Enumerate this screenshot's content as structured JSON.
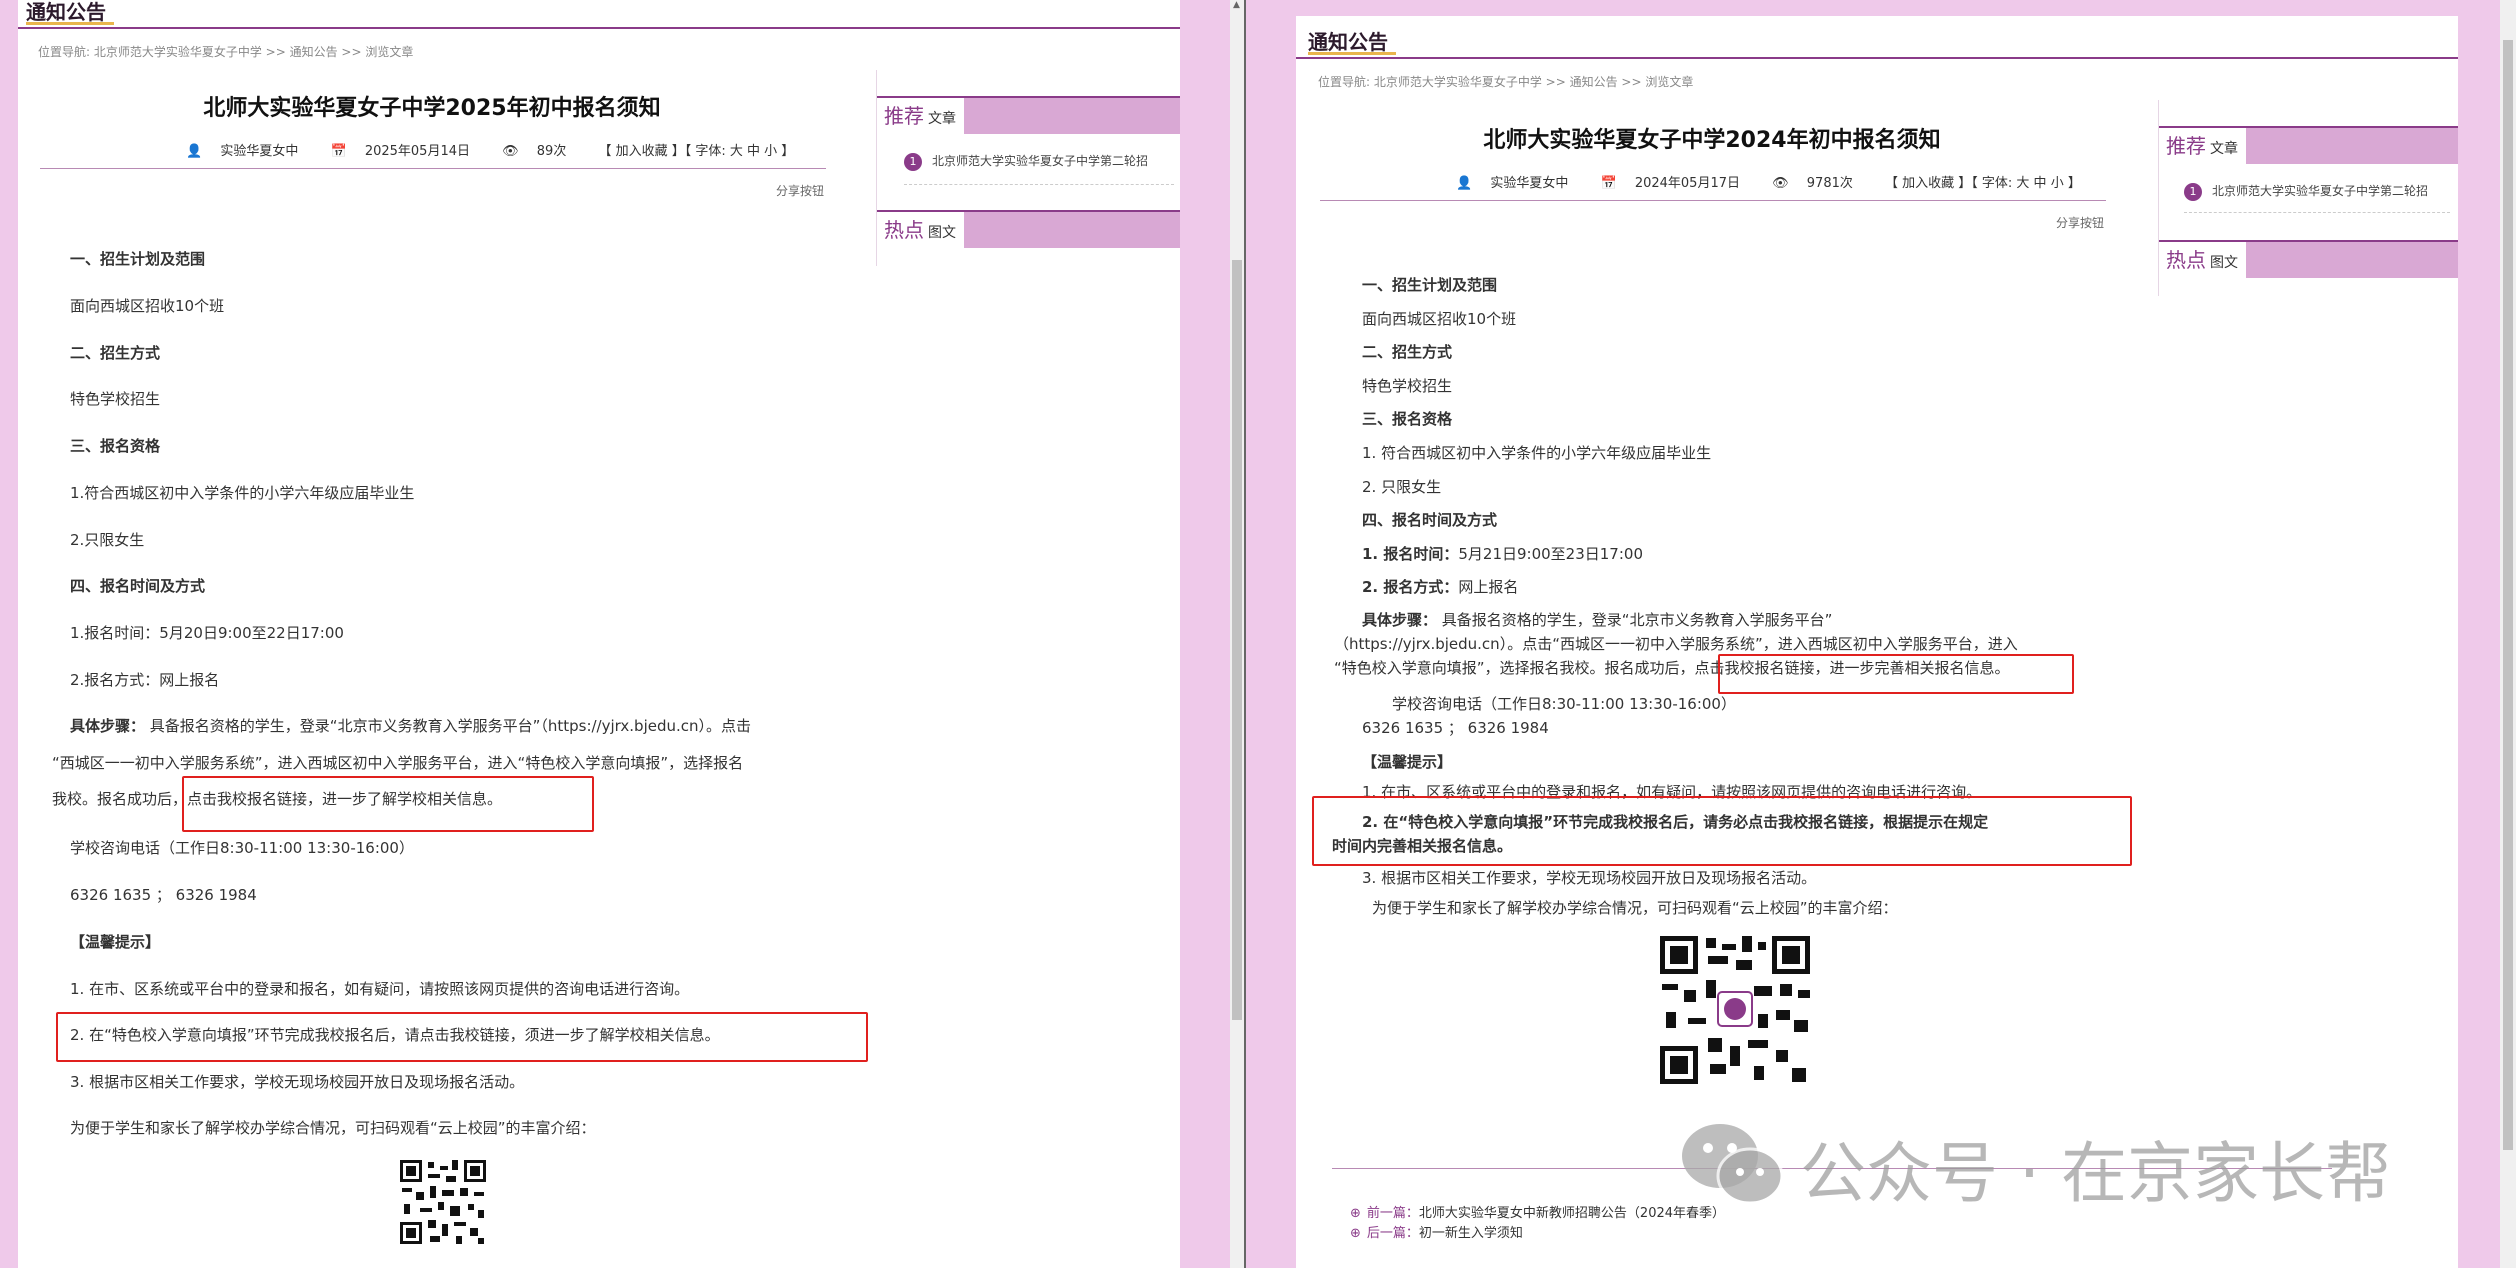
{
  "section_title": "通知公告",
  "breadcrumb": "位置导航: 北京师范大学实验华夏女子中学 >> 通知公告 >> 浏览文章",
  "share_label": "分享按钮",
  "sidebar": {
    "recommend_title": "推荐",
    "recommend_sub": "文章",
    "recommend_item_num": "1",
    "recommend_item": "北京师范大学实验华夏女子中学第二轮招",
    "hot_title": "热点",
    "hot_sub": "图文"
  },
  "left": {
    "title": "北师大实验华夏女子中学2025年初中报名须知",
    "meta": {
      "author": "实验华夏女中",
      "date": "2025年05月14日",
      "views": "89次",
      "actions": "【 加入收藏 】【 字体: 大 中 小 】"
    },
    "paragraphs": [
      "一、招生计划及范围",
      "面向西城区招收10个班",
      "二、招生方式",
      "特色学校招生",
      "三、报名资格",
      "1.符合西城区初中入学条件的小学六年级应届毕业生",
      "2.只限女生",
      "四、报名时间及方式",
      "1.报名时间：5月20日9:00至22日17:00",
      "2.报名方式：网上报名"
    ],
    "steps_label": "具体步骤：",
    "steps_line1": "具备报名资格的学生，登录“北京市义务教育入学服务平台”（https://yjrx.bjedu.cn）。点击",
    "steps_line2": "“西城区一一初中入学服务系统”，进入西城区初中入学服务平台，进入“特色校入学意向填报”，选择报名",
    "steps_line3a": "我校。报名成功后，",
    "steps_line3b": "点击我校报名链接，进一步了解学校相关信息。",
    "phone_label": "学校咨询电话（工作日8:30-11:00  13:30-16:00）",
    "phone_numbers": "6326 1635  ；  6326 1984",
    "tips_title": "【温馨提示】",
    "tip1": "1. 在市、区系统或平台中的登录和报名，如有疑问，请按照该网页提供的咨询电话进行咨询。",
    "tip2": "2. 在“特色校入学意向填报”环节完成我校报名后，请点击我校链接，须进一步了解学校相关信息。",
    "tip3": "3. 根据市区相关工作要求，学校无现场校园开放日及现场报名活动。",
    "intro": "为便于学生和家长了解学校办学综合情况，可扫码观看“云上校园”的丰富介绍："
  },
  "right": {
    "title": "北师大实验华夏女子中学2024年初中报名须知",
    "meta": {
      "author": "实验华夏女中",
      "date": "2024年05月17日",
      "views": "9781次",
      "actions": "【 加入收藏 】【 字体: 大 中 小 】"
    },
    "paragraphs": [
      "一、招生计划及范围",
      "面向西城区招收10个班",
      "二、招生方式",
      "特色学校招生",
      "三、报名资格",
      "1. 符合西城区初中入学条件的小学六年级应届毕业生",
      "2. 只限女生",
      "四、报名时间及方式"
    ],
    "time_label": "1. 报名时间：",
    "time_value": "5月21日9:00至23日17:00",
    "method_label": "2. 报名方式：",
    "method_value": "网上报名",
    "steps_label": "具体步骤：",
    "steps_line1": "具备报名资格的学生，登录“北京市义务教育入学服务平台”",
    "steps_line2": "（https://yjrx.bjedu.cn）。点击“西城区一一初中入学服务系统”，进入西城区初中入学服务平台，进入",
    "steps_line3a": "“特色校入学意向填报”，选择报名我校。报名成功后，",
    "steps_line3b": "点击我校报名链接，进一步完善相关报名信息。",
    "phone_label": "学校咨询电话（工作日8:30-11:00  13:30-16:00）",
    "phone_numbers": "6326 1635  ；  6326 1984",
    "tips_title": "【温馨提示】",
    "tip1": "1. 在市、区系统或平台中的登录和报名，如有疑问，请按照该网页提供的咨询电话进行咨询。",
    "tip2a": "2. 在“特色校入学意向填报”环节完成我校报名后，请务必点击我校报名链接，根据提示在规定",
    "tip2b": "时间内完善相关报名信息。",
    "tip3": "3. 根据市区相关工作要求，学校无现场校园开放日及现场报名活动。",
    "intro": "为便于学生和家长了解学校办学综合情况，可扫码观看“云上校园”的丰富介绍：",
    "prev_label": "前一篇：",
    "prev_value": "北师大实验华夏女中新教师招聘公告（2024年春季）",
    "next_label": "后一篇：",
    "next_value": "初一新生入学须知"
  },
  "watermark": "公众号 · 在京家长帮",
  "colors": {
    "background": "#efc9ea",
    "accent": "#8a3b89",
    "highlight": "#e0201e",
    "tab_fill": "#d9a8d4"
  },
  "icons": [
    "user-icon",
    "calendar-icon",
    "eye-icon",
    "wechat-icon",
    "qr-code"
  ]
}
